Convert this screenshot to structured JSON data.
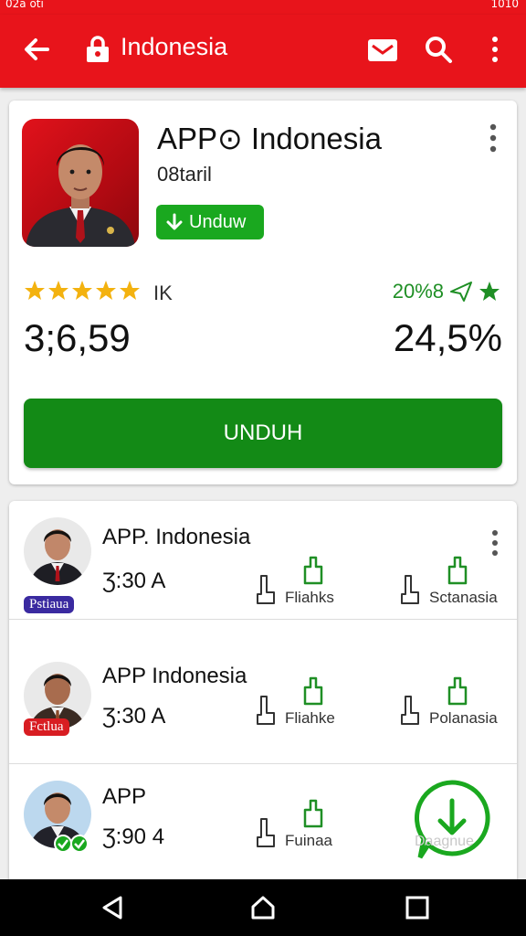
{
  "status_bar": {
    "left_text": "02a oti",
    "right_text": "1010"
  },
  "app_bar": {
    "title": "Indonesia"
  },
  "hero": {
    "app_name": "APP⊙ Indonesia",
    "subtitle": "08taril",
    "install_chip_label": "Unduw",
    "rating_stars": 5,
    "rating_count": "IK",
    "green_stat": "20%8",
    "big_left_value": "3;6,59",
    "big_right_value": "24,5%",
    "primary_button_label": "UNDUH"
  },
  "list": {
    "rows": [
      {
        "title": "APP. Indonesia",
        "time": "Ʒ:30 A",
        "badge": "Pstiaua",
        "badge_color": "#3a2aa0",
        "actions": [
          "Fliahks",
          "Sctanasia"
        ]
      },
      {
        "title": "APP Indonesia",
        "time": "Ʒ:30 A",
        "badge": "Fctlua",
        "badge_color": "#d81d22",
        "actions": [
          "Fliahke",
          "Polanasia"
        ]
      },
      {
        "title": "APP",
        "time": "Ʒ:90 4",
        "badge": "",
        "badge_color": "#1aa81f",
        "actions": [
          "Fuinaa"
        ]
      }
    ]
  },
  "fab": {
    "watermark": "Daagnue",
    "icon": "download-icon"
  },
  "colors": {
    "brand_red": "#e8141b",
    "primary_green": "#138a16",
    "chip_green": "#1aa81f"
  }
}
